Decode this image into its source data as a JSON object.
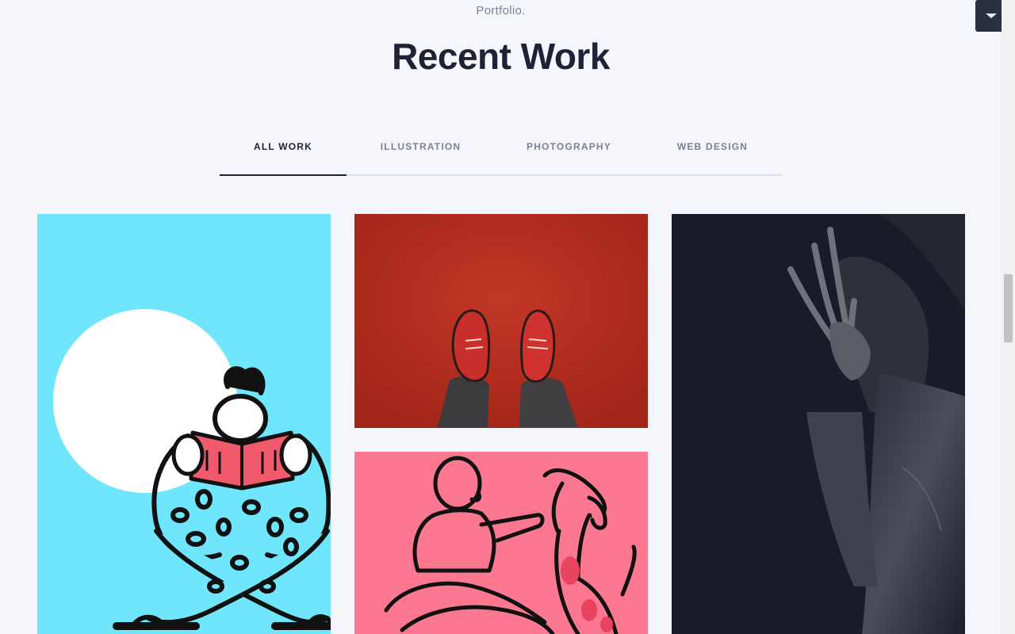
{
  "header": {
    "eyebrow": "Portfolio.",
    "title": "Recent Work"
  },
  "tabs": [
    {
      "label": "ALL WORK",
      "active": true
    },
    {
      "label": "ILLUSTRATION",
      "active": false
    },
    {
      "label": "PHOTOGRAPHY",
      "active": false
    },
    {
      "label": "WEB DESIGN",
      "active": false
    }
  ],
  "portfolio": [
    {
      "category": "illustration",
      "image": "reading-figure-illustration",
      "background": "#6fe6fc"
    },
    {
      "category": "photography",
      "image": "red-sneakers-photo",
      "background": "#b22e20"
    },
    {
      "category": "illustration",
      "image": "man-with-dog-illustration",
      "background": "#fc7890"
    },
    {
      "category": "photography",
      "image": "portrait-dark-photo",
      "background": "#181b28"
    }
  ],
  "controls": {
    "scroll_button_icon": "caret-down-icon"
  },
  "colors": {
    "page_background": "#f5f6fb",
    "title": "#1d2236",
    "muted_text": "#7b8196",
    "tab_rule": "#dde0ec"
  }
}
